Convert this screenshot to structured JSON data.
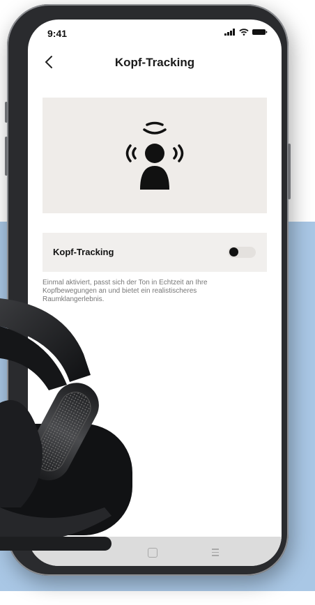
{
  "status_bar": {
    "time": "9:41"
  },
  "header": {
    "title": "Kopf-Tracking",
    "back_icon": "chevron-left-icon"
  },
  "illustration": {
    "icon": "head-tracking-icon"
  },
  "setting": {
    "label": "Kopf-Tracking",
    "toggle_on": false
  },
  "description": "Einmal aktiviert, passt sich der Ton in Echtzeit an Ihre Kopfbewegungen an und bietet ein realistischeres Raumklangerlebnis.",
  "colors": {
    "background_blue": "#a9c7e5",
    "card": "#efece9",
    "phone_frame": "#2a2b2e"
  }
}
